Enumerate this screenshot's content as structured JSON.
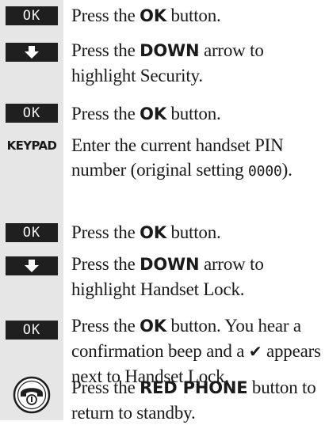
{
  "key_labels": {
    "ok": "OK",
    "keypad": "KEYPAD"
  },
  "icons": {
    "down": "down-arrow-icon",
    "red_phone": "red-phone-icon"
  },
  "steps": [
    {
      "key": "OK",
      "pre": "Press the ",
      "strong": "OK",
      "post": " button."
    },
    {
      "key": "DOWN",
      "pre": "Press the ",
      "strong": "DOWN",
      "post": " arrow to highlight Security."
    },
    {
      "key": "OK",
      "pre": "Press the ",
      "strong": "OK",
      "post": " button."
    },
    {
      "key": "KEYPAD",
      "pre": "Enter the current handset PIN number (original setting ",
      "mono": "0000",
      "post": ")."
    },
    {
      "key": "OK",
      "pre": "Press the ",
      "strong": "OK",
      "post": " button."
    },
    {
      "key": "DOWN",
      "pre": "Press the ",
      "strong": "DOWN",
      "post": " arrow to highlight Handset Lock."
    },
    {
      "key": "OK",
      "pre": "Press the ",
      "strong": "OK",
      "post": " button. You hear a confirmation beep and a ",
      "check": "✔",
      "post2": " appears next to Handset Lock."
    },
    {
      "key": "RED PHONE",
      "pre": "Press the ",
      "strong": "RED PHONE",
      "post": " button to return to standby."
    }
  ]
}
